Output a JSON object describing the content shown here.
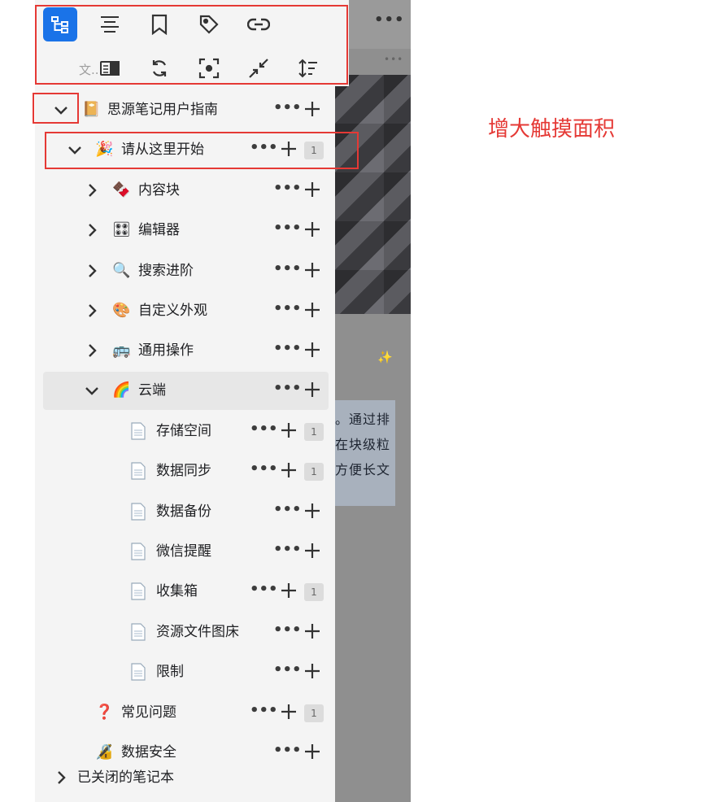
{
  "toolbar": {
    "buttons_row1": [
      "outline-icon",
      "align-icon",
      "bookmark-icon",
      "tag-icon",
      "link-icon"
    ],
    "search_label": "文..",
    "buttons_row2": [
      "panel-icon",
      "refresh-icon",
      "focus-icon",
      "collapse-icon",
      "sort-icon"
    ]
  },
  "editor": {
    "pencil": "✎",
    "more": "•••",
    "sparkle": "✨",
    "lines": [
      "。通过排",
      "在块级粒",
      "方便长文"
    ]
  },
  "tree": {
    "notebook": {
      "label": "思源笔记用户指南",
      "emoji": "📔"
    },
    "start": {
      "label": "请从这里开始",
      "emoji": "🎉",
      "count": "1"
    },
    "items": [
      {
        "label": "内容块",
        "emoji": "🍫"
      },
      {
        "label": "编辑器",
        "emoji": "🎛"
      },
      {
        "label": "搜索进阶",
        "emoji": "🔍"
      },
      {
        "label": "自定义外观",
        "emoji": "🎨"
      },
      {
        "label": "通用操作",
        "emoji": "🚌"
      },
      {
        "label": "云端",
        "emoji": "🌈"
      }
    ],
    "cloud_children": [
      {
        "label": "存储空间",
        "count": "1"
      },
      {
        "label": "数据同步",
        "count": "1"
      },
      {
        "label": "数据备份",
        "count": ""
      },
      {
        "label": "微信提醒",
        "count": ""
      },
      {
        "label": "收集箱",
        "count": "1"
      },
      {
        "label": "资源文件图床",
        "count": ""
      },
      {
        "label": "限制",
        "count": ""
      }
    ],
    "faq": {
      "label": "常见问题",
      "emoji": "❓",
      "count": "1"
    },
    "security": {
      "label": "数据安全",
      "emoji": "🔏"
    },
    "closed": {
      "label": "已关闭的笔记本"
    }
  },
  "row_more": "•••",
  "annotation": "增大触摸面积",
  "colors": {
    "accent": "#1a73e8",
    "annotation": "#e53935",
    "panel": "#f4f4f4"
  }
}
